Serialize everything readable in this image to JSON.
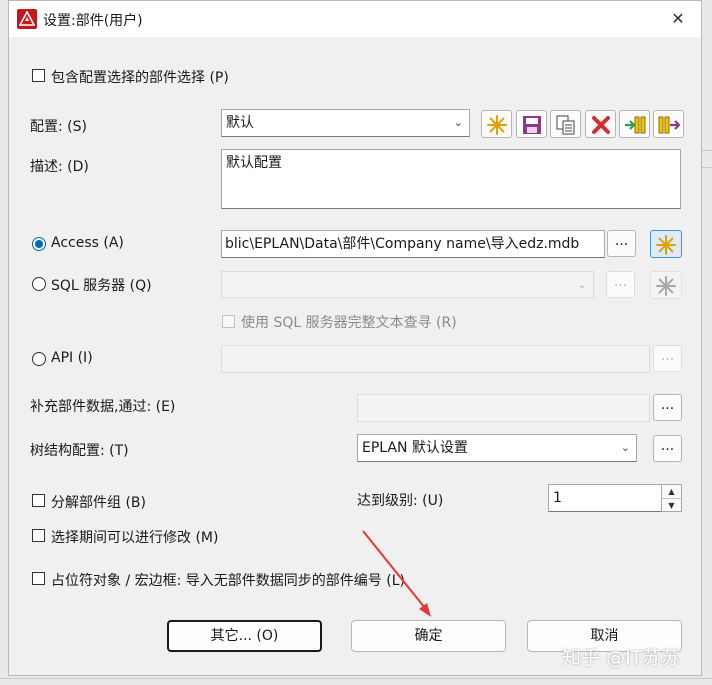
{
  "window": {
    "title": "设置:部件(用户)",
    "close_glyph": "✕"
  },
  "include_config": {
    "label": "包含配置选择的部件选择 (P)",
    "checked": false
  },
  "config": {
    "label": "配置: (S)",
    "value": "默认"
  },
  "description": {
    "label": "描述: (D)",
    "value": "默认配置"
  },
  "access": {
    "label": "Access (A)",
    "path": "blic\\EPLAN\\Data\\部件\\Company name\\导入edz.mdb",
    "selected": true
  },
  "sql": {
    "label": "SQL 服务器 (Q)",
    "value": "",
    "fulltext_label": "使用 SQL 服务器完整文本查寻 (R)"
  },
  "api": {
    "label": "API (I)",
    "value": ""
  },
  "supplement": {
    "label": "补充部件数据,通过: (E)",
    "value": ""
  },
  "tree_config": {
    "label": "树结构配置: (T)",
    "value": "EPLAN 默认设置"
  },
  "decompose": {
    "label": "分解部件组 (B)",
    "checked": false
  },
  "level": {
    "label": "达到级别: (U)",
    "value": "1"
  },
  "modify": {
    "label": "选择期间可以进行修改 (M)",
    "checked": false
  },
  "placeholder": {
    "label": "占位符对象 / 宏边框: 导入无部件数据同步的部件编号 (L)",
    "checked": false
  },
  "ellipsis": "...",
  "buttons": {
    "other": "其它... (O)",
    "ok": "确定",
    "cancel": "取消"
  },
  "watermark": "知乎 @IT苏苏",
  "colors": {
    "accent": "#0067c0",
    "annotation_arrow": "#e53935",
    "delete_red": "#d32f2f",
    "star_gold": "#e0a000"
  }
}
